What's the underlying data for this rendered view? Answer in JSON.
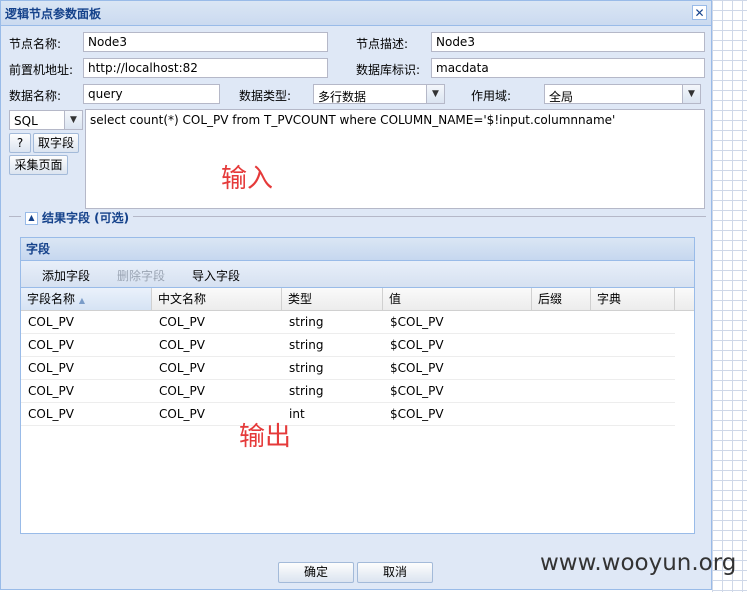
{
  "dialog": {
    "title": "逻辑节点参数面板",
    "close_symbol": "✕"
  },
  "form": {
    "node_name_label": "节点名称:",
    "node_name_value": "Node3",
    "node_desc_label": "节点描述:",
    "node_desc_value": "Node3",
    "host_label": "前置机地址:",
    "host_value": "http://localhost:82",
    "db_label": "数据库标识:",
    "db_value": "macdata",
    "data_name_label": "数据名称:",
    "data_name_value": "query",
    "data_type_label": "数据类型:",
    "data_type_value": "多行数据",
    "scope_label": "作用域:",
    "scope_value": "全局"
  },
  "sql": {
    "type_value": "SQL",
    "help_button": "?",
    "fetch_field_button": "取字段",
    "collect_page_button": "采集页面",
    "query_text": "select count(*) COL_PV from T_PVCOUNT where COLUMN_NAME='$!input.columnname'"
  },
  "annotations": {
    "input": "输入",
    "output": "输出"
  },
  "result_section": {
    "legend": "结果字段 (可选)",
    "toggle_symbol": "▲",
    "grid_title": "字段",
    "toolbar": {
      "add": "添加字段",
      "delete": "删除字段",
      "import": "导入字段"
    },
    "columns": [
      "字段名称",
      "中文名称",
      "类型",
      "值",
      "后缀",
      "字典"
    ],
    "sort_indicator": "▲",
    "rows": [
      [
        "COL_PV",
        "COL_PV",
        "string",
        "$COL_PV",
        "",
        ""
      ],
      [
        "COL_PV",
        "COL_PV",
        "string",
        "$COL_PV",
        "",
        ""
      ],
      [
        "COL_PV",
        "COL_PV",
        "string",
        "$COL_PV",
        "",
        ""
      ],
      [
        "COL_PV",
        "COL_PV",
        "string",
        "$COL_PV",
        "",
        ""
      ],
      [
        "COL_PV",
        "COL_PV",
        "int",
        "$COL_PV",
        "",
        ""
      ]
    ]
  },
  "footer": {
    "ok": "确定",
    "cancel": "取消"
  },
  "watermark": "www.wooyun.org",
  "colors": {
    "panel_bg": "#dfe8f6",
    "title_text": "#15428b",
    "annotation": "#e53a3a",
    "border": "#99bbe8"
  }
}
